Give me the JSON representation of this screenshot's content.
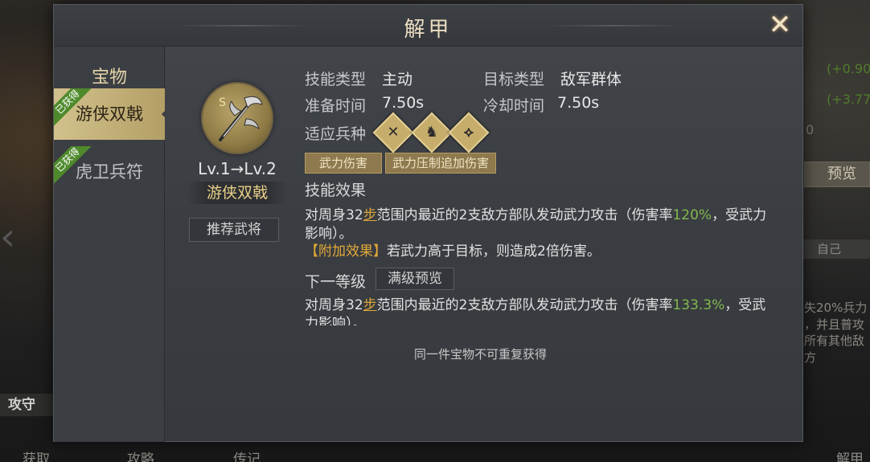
{
  "background": {
    "right_values": [
      "(+0.90",
      "(+3.77",
      "0"
    ],
    "preview_button": "预览",
    "self_pill": "自己",
    "right_text_lines": [
      "失20%兵力",
      "，并且普攻",
      "所有其他敌方"
    ],
    "attack_defense": "攻守",
    "bottom_items": [
      "获取",
      "攻略",
      "传记",
      "解甲"
    ]
  },
  "dialog": {
    "title": "解甲",
    "close_icon": "close-x-icon"
  },
  "sidebar": {
    "title": "宝物",
    "items": [
      {
        "label": "游侠双戟",
        "badge": "已获得",
        "active": true
      },
      {
        "label": "虎卫兵符",
        "badge": "已获得",
        "active": false
      }
    ]
  },
  "item": {
    "icon": "twin-halberd-icon",
    "level_text": "Lv.1→Lv.2",
    "name": "游侠双戟",
    "recommend_button": "推荐武将"
  },
  "skill": {
    "type_label": "技能类型",
    "type_value": "主动",
    "target_label": "目标类型",
    "target_value": "敌军群体",
    "prep_label": "准备时间",
    "prep_value": "7.50s",
    "cooldown_label": "冷却时间",
    "cooldown_value": "7.50s",
    "troop_label": "适应兵种",
    "troop_icons": [
      "crossed-spears-icon",
      "horse-head-icon",
      "bow-icon"
    ],
    "tags": [
      "武力伤害",
      "武力压制追加伤害"
    ],
    "effect_title": "技能效果",
    "effect_prefix": "对周身32",
    "effect_step": "步",
    "effect_mid": "范围内最近的2支敌方部队发动武力攻击（伤害率",
    "effect_rate": "120%",
    "effect_suffix": "，受武力影响）。",
    "bonus_tag": "【附加效果】",
    "bonus_text": "若武力高于目标，则造成2倍伤害。",
    "next_level_label": "下一等级",
    "max_level_button": "满级预览",
    "next_prefix": "对周身32",
    "next_step": "步",
    "next_mid": "范围内最近的2支敌方部队发动武力攻击（伤害率",
    "next_rate": "133.3%",
    "next_suffix": "，受武力影响）。"
  },
  "footer_note": "同一件宝物不可重复获得",
  "colors": {
    "gold": "#e8cf87",
    "green": "#83b84e",
    "orange_highlight": "#e0a838",
    "badge_green": "#4e8a2b"
  }
}
